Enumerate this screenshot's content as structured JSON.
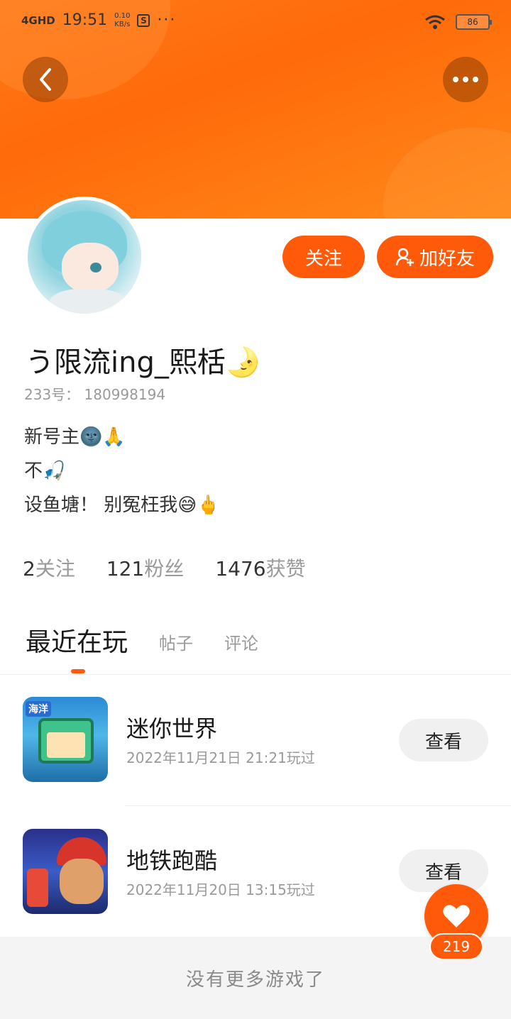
{
  "status_bar": {
    "signal": "4GHD",
    "time": "19:51",
    "speed_value": "0.10",
    "speed_unit": "KB/s",
    "more": "···",
    "battery": "86"
  },
  "profile": {
    "follow_label": "关注",
    "add_friend_label": "加好友",
    "username": "う限流ing_熙栝🌛",
    "user_id": "233号：  180998194",
    "bio_lines": [
      "新号主🌚🙏",
      "不🎣",
      "设鱼塘！ 别冤枉我😅🖕"
    ]
  },
  "stats": {
    "following_count": "2",
    "following_label": "关注",
    "fans_count": "121",
    "fans_label": "粉丝",
    "likes_count": "1476",
    "likes_label": "获赞"
  },
  "tabs": [
    "最近在玩",
    "帖子",
    "评论"
  ],
  "games": [
    {
      "title": "迷你世界",
      "time": "2022年11月21日  21:21玩过",
      "view_label": "查看",
      "icon": "mini-world-icon",
      "badge": "海洋"
    },
    {
      "title": "地铁跑酷",
      "time": "2022年11月20日  13:15玩过",
      "view_label": "查看",
      "icon": "subway-surfers-icon"
    }
  ],
  "like_fab": {
    "count": "219"
  },
  "footer": {
    "text": "没有更多游戏了"
  },
  "colors": {
    "accent": "#ff5a0a",
    "header": "#ff7a1a"
  }
}
